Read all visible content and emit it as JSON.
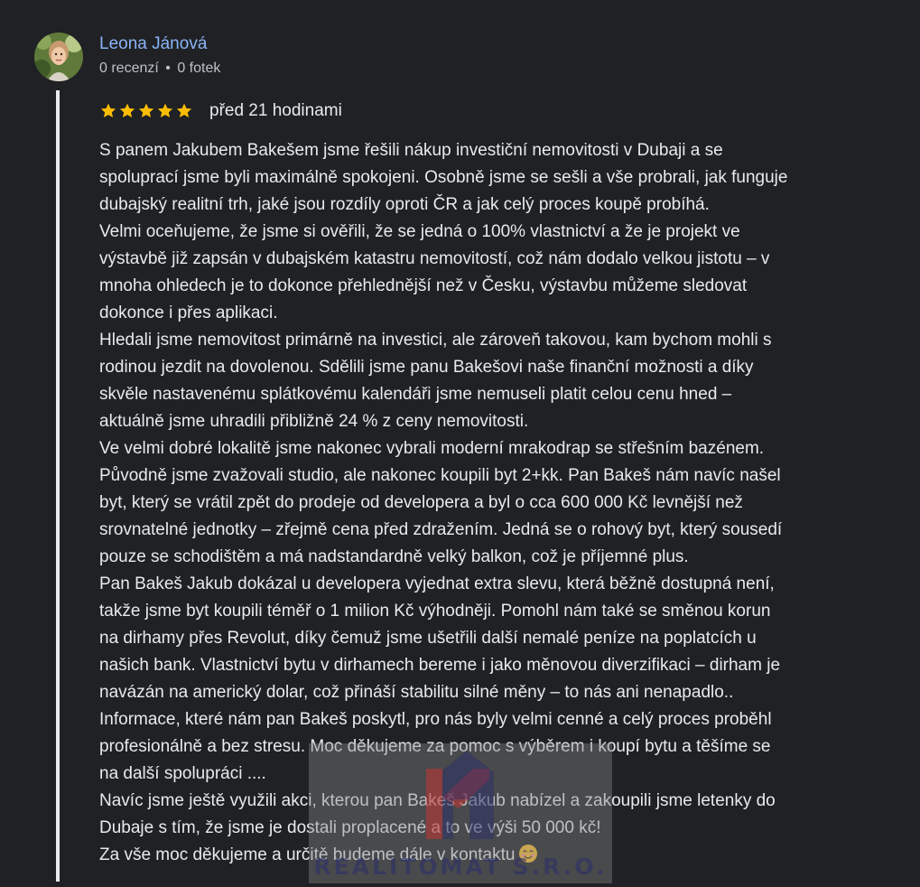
{
  "author": {
    "name": "Leona Jánová",
    "reviews": "0 recenzí",
    "separator": "•",
    "photos": "0 fotek"
  },
  "review": {
    "rating": 5,
    "rating_max": 5,
    "date": "před 21 hodinami",
    "lines": [
      "S panem Jakubem Bakešem jsme řešili nákup investiční nemovitosti v Dubaji a se",
      "spoluprací jsme byli maximálně spokojeni. Osobně jsme se sešli a vše probrali, jak funguje",
      "dubajský realitní trh, jaké jsou rozdíly oproti ČR a jak celý proces koupě probíhá.",
      "Velmi oceňujeme, že jsme si ověřili, že se jedná o 100% vlastnictví a že je projekt ve",
      "výstavbě již zapsán v dubajském katastru nemovitostí, což nám dodalo velkou jistotu – v",
      "mnoha ohledech je to dokonce přehlednější než v Česku, výstavbu můžeme sledovat",
      "dokonce i přes aplikaci.",
      "Hledali jsme nemovitost primárně na investici, ale zároveň takovou, kam bychom mohli s",
      "rodinou jezdit na dovolenou. Sdělili jsme panu Bakešovi naše finanční možnosti a díky",
      "skvěle nastavenému splátkovému kalendáři jsme nemuseli platit celou cenu hned –",
      "aktuálně jsme uhradili přibližně 24 % z ceny nemovitosti.",
      "Ve velmi dobré lokalitě jsme nakonec vybrali moderní mrakodrap se střešním bazénem.",
      "Původně jsme zvažovali studio, ale nakonec koupili byt 2+kk. Pan Bakeš nám navíc našel",
      "byt, který se vrátil zpět do prodeje od developera a byl o cca 600 000 Kč levnější než",
      "srovnatelné jednotky – zřejmě cena před zdražením. Jedná se o rohový byt, který sousedí",
      "pouze se schodištěm a má nadstandardně velký balkon, což je příjemné plus.",
      "Pan Bakeš Jakub dokázal u developera vyjednat extra slevu, která běžně dostupná není,",
      "takže jsme byt koupili téměř o 1 milion Kč výhodněji. Pomohl nám také se směnou korun",
      "na dirhamy přes Revolut, díky čemuž jsme ušetřili další nemalé peníze na poplatcích u",
      "našich bank. Vlastnictví bytu v dirhamech bereme i jako měnovou diverzifikaci – dirham je",
      "navázán na americký dolar, což přináší stabilitu silné měny – to nás ani nenapadlo..",
      "Informace, které nám pan Bakeš poskytl, pro nás byly velmi cenné a celý proces proběhl",
      "profesionálně a bez stresu. Moc děkujeme za pomoc s výběrem i koupí bytu a těšíme se",
      "na další spolupráci ....",
      "Navíc jsme ještě využili akci, kterou pan Bakeš Jakub nabízel a zakoupili jsme letenky do",
      "Dubaje s tím, že jsme je dostali proplacené a to ve výši 50 000 kč!",
      "Za vše moc děkujeme a určitě budeme dále v kontaktu"
    ]
  },
  "watermark": {
    "text": "REALITOMAT S.R.O."
  },
  "colors": {
    "background": "#202124",
    "author_name": "#8ab4f8",
    "text": "#e8eaed",
    "meta": "#bdc1c6",
    "star": "#fbbc04"
  },
  "icons": {
    "star": "star-icon",
    "emoji": "smiling-face-icon",
    "logo": "realitomat-logo-icon"
  }
}
